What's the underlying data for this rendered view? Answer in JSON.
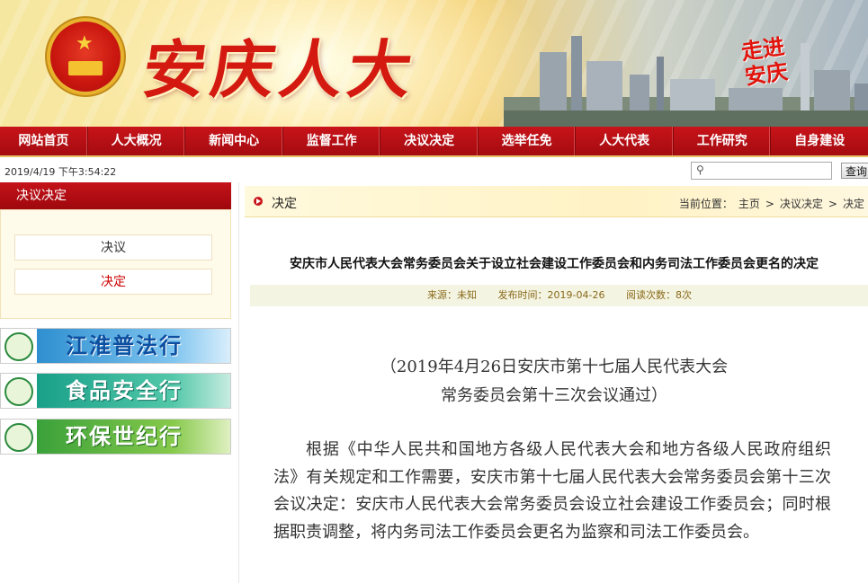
{
  "header": {
    "site_title": "安庆人大",
    "slogan": "走进安庆"
  },
  "nav": [
    {
      "label": "网站首页"
    },
    {
      "label": "人大概况"
    },
    {
      "label": "新闻中心"
    },
    {
      "label": "监督工作"
    },
    {
      "label": "决议决定"
    },
    {
      "label": "选举任免"
    },
    {
      "label": "人大代表"
    },
    {
      "label": "工作研究"
    },
    {
      "label": "自身建设"
    }
  ],
  "infobar": {
    "datetime": "2019/4/19 下午3:54:22",
    "search_placeholder": "",
    "search_button": "查询"
  },
  "sidebar": {
    "title": "决议决定",
    "items": [
      {
        "label": "决议",
        "active": false
      },
      {
        "label": "决定",
        "active": true
      }
    ],
    "promos": [
      {
        "label": "江淮普法行"
      },
      {
        "label": "食品安全行"
      },
      {
        "label": "环保世纪行"
      }
    ]
  },
  "main": {
    "section": "决定",
    "breadcrumb": {
      "prefix": "当前位置：",
      "items": [
        "主页",
        "决议决定",
        "决定"
      ],
      "sep": ">"
    },
    "article": {
      "title": "安庆市人民代表大会常务委员会关于设立社会建设工作委员会和内务司法工作委员会更名的决定",
      "source": "来源：未知",
      "published": "发布时间：2019-04-26",
      "views": "阅读次数：8次",
      "subtitle_line1": "（2019年4月26日安庆市第十七届人民代表大会",
      "subtitle_line2": "常务委员会第十三次会议通过）",
      "body": "根据《中华人民共和国地方各级人民代表大会和地方各级人民政府组织法》有关规定和工作需要，安庆市第十七届人民代表大会常务委员会第十三次会议决定：安庆市人民代表大会常务委员会设立社会建设工作委员会；同时根据职责调整，将内务司法工作委员会更名为监察和司法工作委员会。"
    }
  },
  "colors": {
    "nav_red": "#b30f14",
    "accent_red": "#c9151a",
    "meta_text": "#8a6a1a"
  }
}
